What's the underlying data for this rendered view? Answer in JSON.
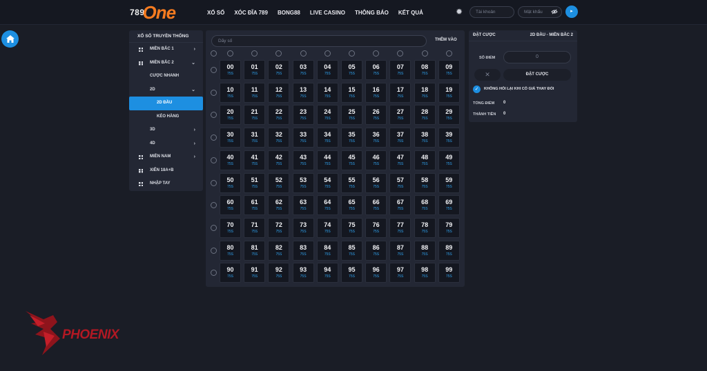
{
  "header": {
    "logo_num": "789",
    "logo_word": "One",
    "nav": [
      "XỔ SỐ",
      "XÓC ĐĨA 789",
      "BONG88",
      "LIVE CASINO",
      "THÔNG BÁO",
      "KẾT QUẢ"
    ],
    "username_placeholder": "Tài khoản",
    "password_placeholder": "Mật khẩu",
    "icons": {
      "settings": "gear-icon",
      "eye": "eye-icon",
      "login": "arrow-right-icon",
      "home": "home-icon"
    }
  },
  "sidebar": {
    "title": "XỔ SỐ TRUYỀN THỐNG",
    "items": [
      {
        "label": "MIỀN BẮC 1",
        "icon": "grid",
        "chevron": "›"
      },
      {
        "label": "MIỀN BẮC 2",
        "icon": "grid",
        "chevron": "⌄"
      },
      {
        "label": "CƯỢC NHANH"
      },
      {
        "label": "2D",
        "chevron": "⌄"
      },
      {
        "label": "2D ĐẦU",
        "active": true
      },
      {
        "label": "KÉO HÀNG"
      },
      {
        "label": "3D",
        "chevron": "›"
      },
      {
        "label": "4D",
        "chevron": "›"
      },
      {
        "label": "MIỀN NAM",
        "icon": "grid",
        "chevron": "›"
      },
      {
        "label": "XIÊN 18A+B",
        "icon": "grid"
      },
      {
        "label": "NHẬP TAY",
        "icon": "grid"
      }
    ]
  },
  "board": {
    "search_placeholder": "Dãy số",
    "add_label": "THÊM VÀO",
    "rate": "75S",
    "numbers": [
      "00",
      "01",
      "02",
      "03",
      "04",
      "05",
      "06",
      "07",
      "08",
      "09",
      "10",
      "11",
      "12",
      "13",
      "14",
      "15",
      "16",
      "17",
      "18",
      "19",
      "20",
      "21",
      "22",
      "23",
      "24",
      "25",
      "26",
      "27",
      "28",
      "29",
      "30",
      "31",
      "32",
      "33",
      "34",
      "35",
      "36",
      "37",
      "38",
      "39",
      "40",
      "41",
      "42",
      "43",
      "44",
      "45",
      "46",
      "47",
      "48",
      "49",
      "50",
      "51",
      "52",
      "53",
      "54",
      "55",
      "56",
      "57",
      "58",
      "59",
      "60",
      "61",
      "62",
      "63",
      "64",
      "65",
      "66",
      "67",
      "68",
      "69",
      "70",
      "71",
      "72",
      "73",
      "74",
      "75",
      "76",
      "77",
      "78",
      "79",
      "80",
      "81",
      "82",
      "83",
      "84",
      "85",
      "86",
      "87",
      "88",
      "89",
      "90",
      "91",
      "92",
      "93",
      "94",
      "95",
      "96",
      "97",
      "98",
      "99"
    ]
  },
  "bet": {
    "title": "ĐẶT CƯỢC",
    "type": "2D ĐẦU - MIỀN BẮC 2",
    "points_label": "SỐ ĐIỂM",
    "points_value": "0",
    "clear_label": "✕",
    "place_label": "ĐẶT CƯỢC",
    "no_ask_label": "KHÔNG HỎI LẠI KHI CÓ GIÁ THAY ĐỔI",
    "total_points_label": "TỔNG ĐIỂM",
    "total_points_value": "0",
    "amount_label": "THÀNH TIỀN",
    "amount_value": "0"
  },
  "watermark": {
    "text": "PHOENIX"
  },
  "colors": {
    "accent": "#1d8fe1",
    "brand": "#f57b20",
    "rate": "#2fa3f0",
    "watermark": "#b21823"
  }
}
